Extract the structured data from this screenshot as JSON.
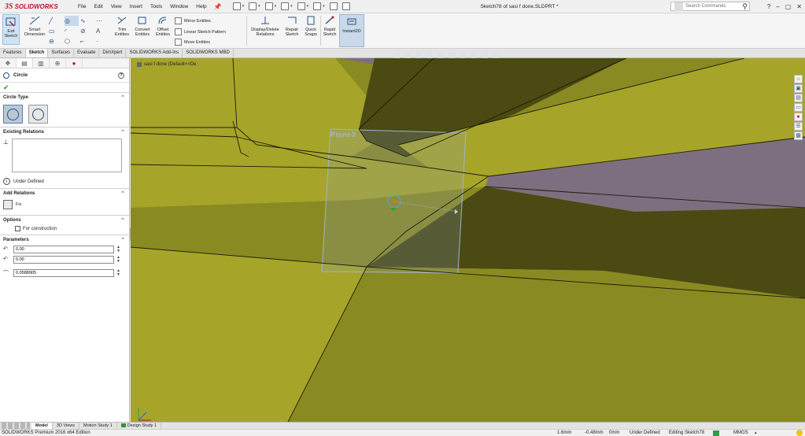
{
  "app": {
    "brand_ds": "3S",
    "brand_name": "SOLIDWORKS",
    "window_title": "Sketch78 of sasi f done.SLDPRT *",
    "menu": [
      "File",
      "Edit",
      "View",
      "Insert",
      "Tools",
      "Window",
      "Help"
    ],
    "search_placeholder": "Search Commands",
    "window_controls": [
      "?",
      "–",
      "▢",
      "✕"
    ]
  },
  "ribbon": {
    "exit_sketch": "Exit Sketch",
    "smart_dimension": "Smart Dimension",
    "trim_entities": "Trim Entities",
    "convert_entities": "Convert Entities",
    "offset_entities": "Offset Entities",
    "mirror_entities": "Mirror Entities",
    "linear_sketch_pattern": "Linear Sketch Pattern",
    "move_entities": "Move Entities",
    "display_delete_relations": "Display/Delete Relations",
    "repair_sketch": "Repair Sketch",
    "quick_snaps": "Quick Snaps",
    "rapid_sketch": "Rapid Sketch",
    "instant2d": "Instant2D"
  },
  "tabs": [
    "Features",
    "Sketch",
    "Surfaces",
    "Evaluate",
    "DimXpert",
    "SOLIDWORKS Add-Ins",
    "SOLIDWORKS MBD"
  ],
  "active_tab": "Sketch",
  "property_manager": {
    "title": "Circle",
    "circle_type_label": "Circle Type",
    "existing_relations_label": "Existing Relations",
    "status_text": "Under Defined",
    "add_relations_label": "Add Relations",
    "fix_label": "Fix",
    "options_label": "Options",
    "for_construction_label": "For construction",
    "parameters_label": "Parameters",
    "cx": "0.00",
    "cy": "0.00",
    "radius": "0.0588905"
  },
  "viewport": {
    "breadcrumb": "sasi f done (Default<<De",
    "plane_label": "Plane3"
  },
  "bottom_tabs": [
    "Model",
    "3D Views",
    "Motion Study 1",
    "Design Study 1"
  ],
  "active_bottom_tab": "Model",
  "status": {
    "edition": "SOLIDWORKS Premium 2016 x64 Edition",
    "x": "1.6mm",
    "y": "-0.48mm",
    "z": "0mm",
    "definition": "Under Defined",
    "editing": "Editing Sketch78",
    "units": "MMGS"
  },
  "colors": {
    "face_light": "#a6a52a",
    "face_dark": "#4a4a12",
    "face_mid": "#8a8a22",
    "background_gray": "#7e6f80",
    "plane": "#8ea1b5",
    "accent_red": "#c8102e"
  }
}
